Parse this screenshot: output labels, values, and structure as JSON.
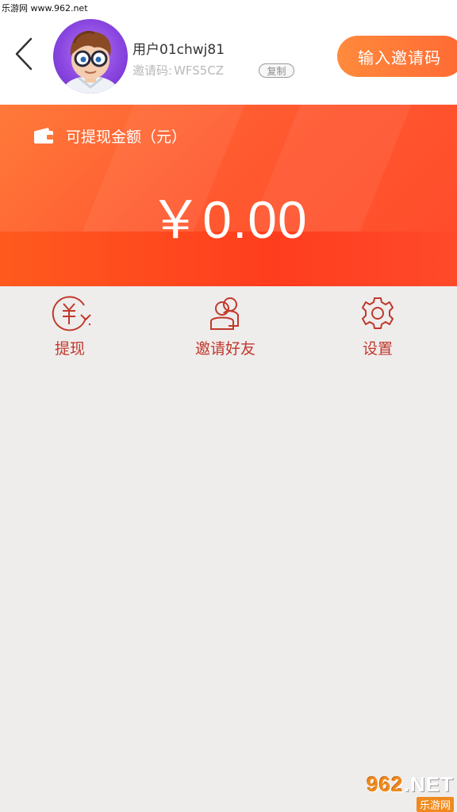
{
  "watermark_top": "乐游网 www.962.net",
  "header": {
    "username": "用户01chwj81",
    "invite_code_label": "邀请码:",
    "invite_code_value": "WFS5CZ",
    "copy_label": "复制",
    "enter_invite_label": "输入邀请码"
  },
  "balance": {
    "label": "可提现金额（元）",
    "amount": "￥0.00"
  },
  "actions": [
    {
      "label": "提现",
      "icon": "yuan-withdraw-icon"
    },
    {
      "label": "邀请好友",
      "icon": "users-icon"
    },
    {
      "label": "设置",
      "icon": "gear-icon"
    }
  ],
  "footer_watermark": {
    "main": "962",
    "net": ".NET",
    "sub": "乐游网"
  },
  "colors": {
    "accent": "#ff5a30",
    "icon_red": "#c0392b",
    "background": "#efecec",
    "button_orange": "#ff7a38"
  }
}
